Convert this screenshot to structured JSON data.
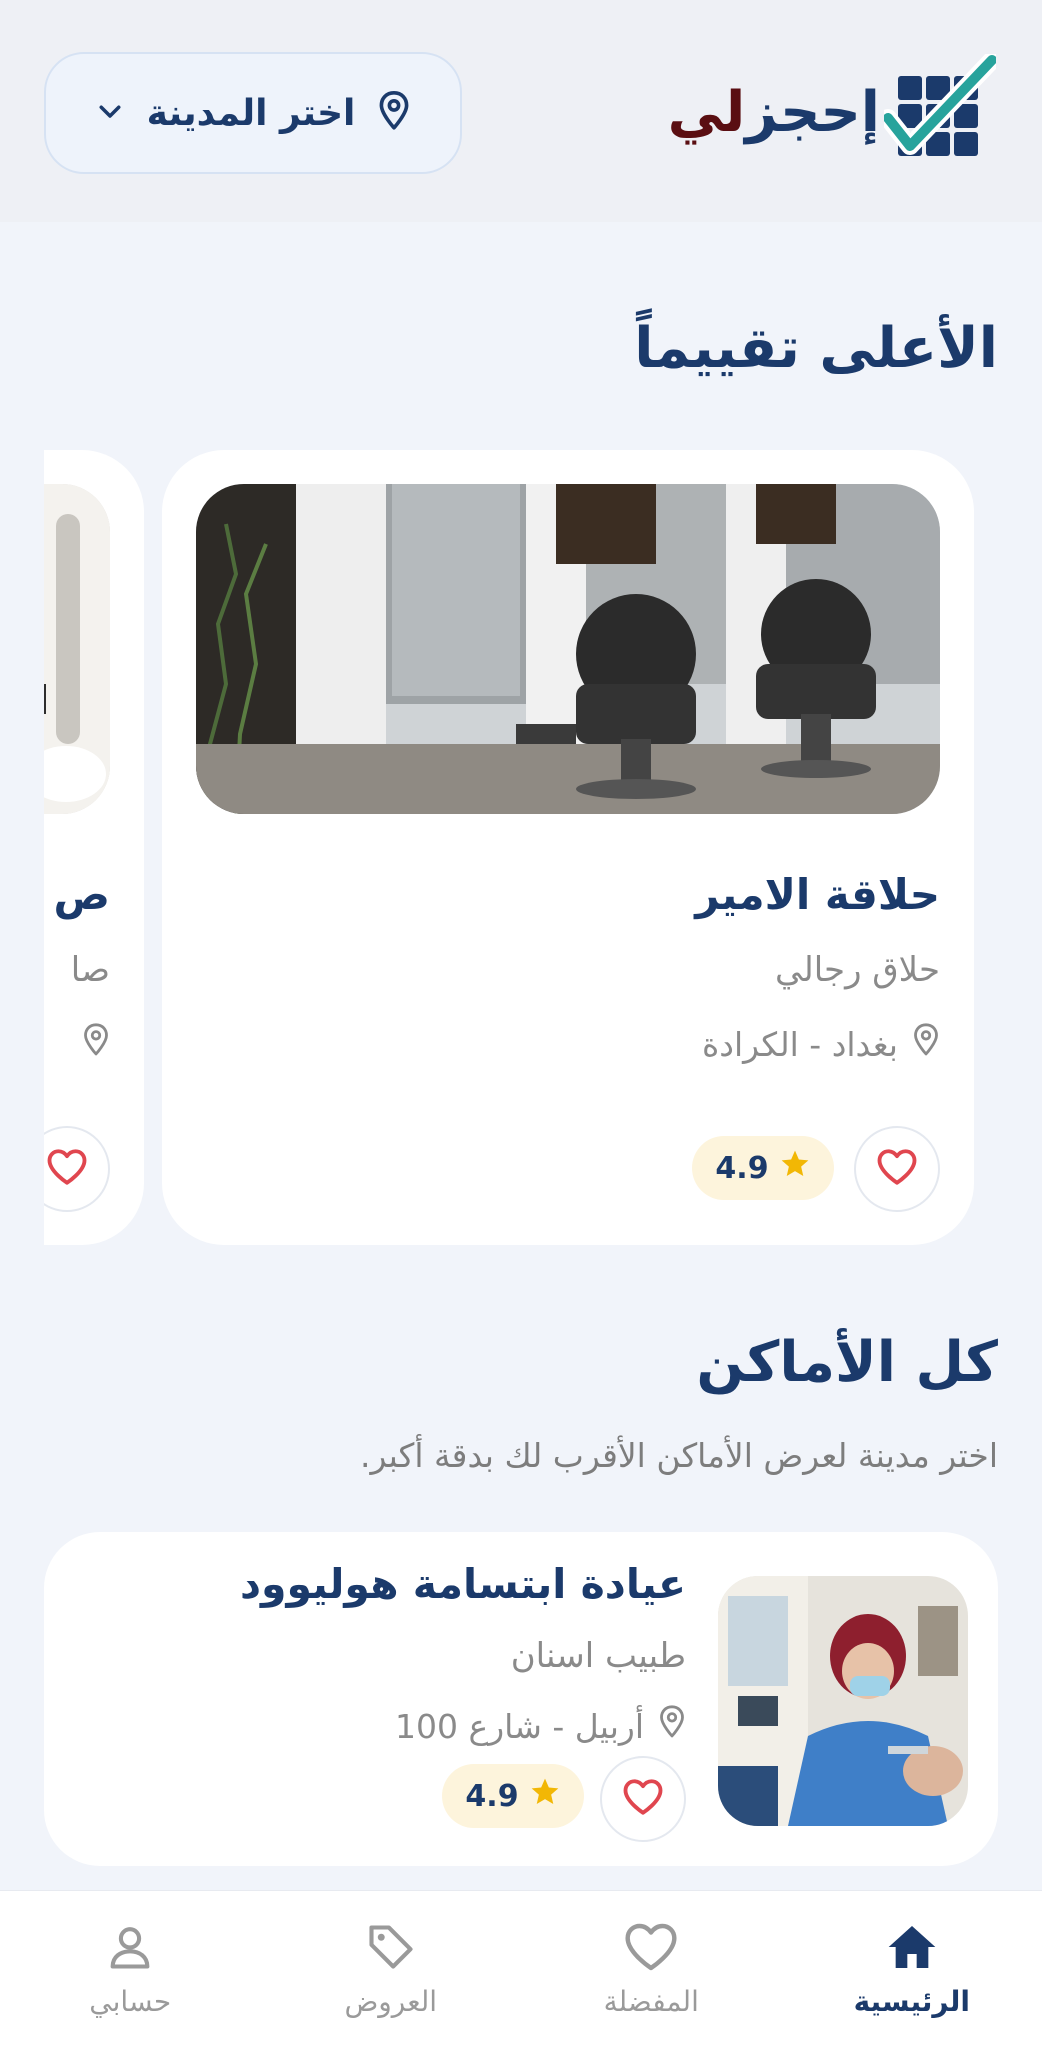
{
  "header": {
    "logo_text_main": "إحجز",
    "logo_text_accent": "لي",
    "city_select_label": "اختر المدينة"
  },
  "top_rated": {
    "title": "الأعلى تقييماً",
    "cards": [
      {
        "name": "حلاقة الامير",
        "category": "حلاق رجالي",
        "location": "بغداد - الكرادة",
        "rating": "4.9"
      },
      {
        "name": "ص",
        "category": "صا"
      }
    ]
  },
  "all_places": {
    "title": "كل الأماكن",
    "subtitle": "اختر مدينة لعرض الأماكن الأقرب لك بدقة أكبر.",
    "items": [
      {
        "name": "عيادة ابتسامة هوليوود",
        "category": "طبيب اسنان",
        "location": "أربيل - شارع 100",
        "rating": "4.9"
      }
    ]
  },
  "bottom_nav": {
    "items": [
      {
        "label": "الرئيسية",
        "icon": "home-icon",
        "active": true
      },
      {
        "label": "المفضلة",
        "icon": "heart-icon",
        "active": false
      },
      {
        "label": "العروض",
        "icon": "tag-icon",
        "active": false
      },
      {
        "label": "حسابي",
        "icon": "user-icon",
        "active": false
      }
    ]
  },
  "colors": {
    "primary": "#1b3a6b",
    "accent_teal": "#27a39c",
    "logo_accent": "#5a0e12",
    "heart": "#e0464f",
    "star": "#f2b705",
    "rating_bg": "#fdf4dc",
    "background": "#f1f4fa"
  }
}
